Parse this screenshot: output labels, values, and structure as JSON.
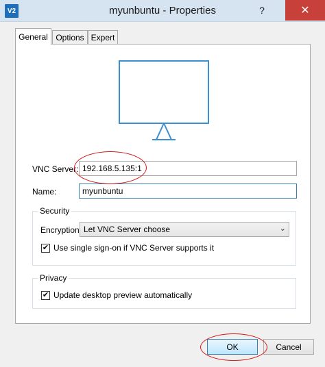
{
  "window": {
    "title": "myunbuntu - Properties",
    "app_icon_text": "V2",
    "help_glyph": "?",
    "close_glyph": "✕"
  },
  "tabs": [
    {
      "label": "General",
      "active": true
    },
    {
      "label": "Options",
      "active": false
    },
    {
      "label": "Expert",
      "active": false
    }
  ],
  "general": {
    "preview_icon": "monitor-icon",
    "vnc_server_label": "VNC Server:",
    "vnc_server_value": "192.168.5.135:1",
    "name_label": "Name:",
    "name_value": "myunbuntu"
  },
  "security": {
    "title": "Security",
    "encryption_label": "Encryption:",
    "encryption_value": "Let VNC Server choose",
    "sso_label": "Use single sign-on if VNC Server supports it",
    "sso_checked": true
  },
  "privacy": {
    "title": "Privacy",
    "preview_label": "Update desktop preview automatically",
    "preview_checked": true
  },
  "footer": {
    "ok_label": "OK",
    "cancel_label": "Cancel"
  },
  "colors": {
    "accent": "#3c7fb1",
    "monitor_stroke": "#3a8fd1",
    "annotation": "#d01a1a"
  }
}
